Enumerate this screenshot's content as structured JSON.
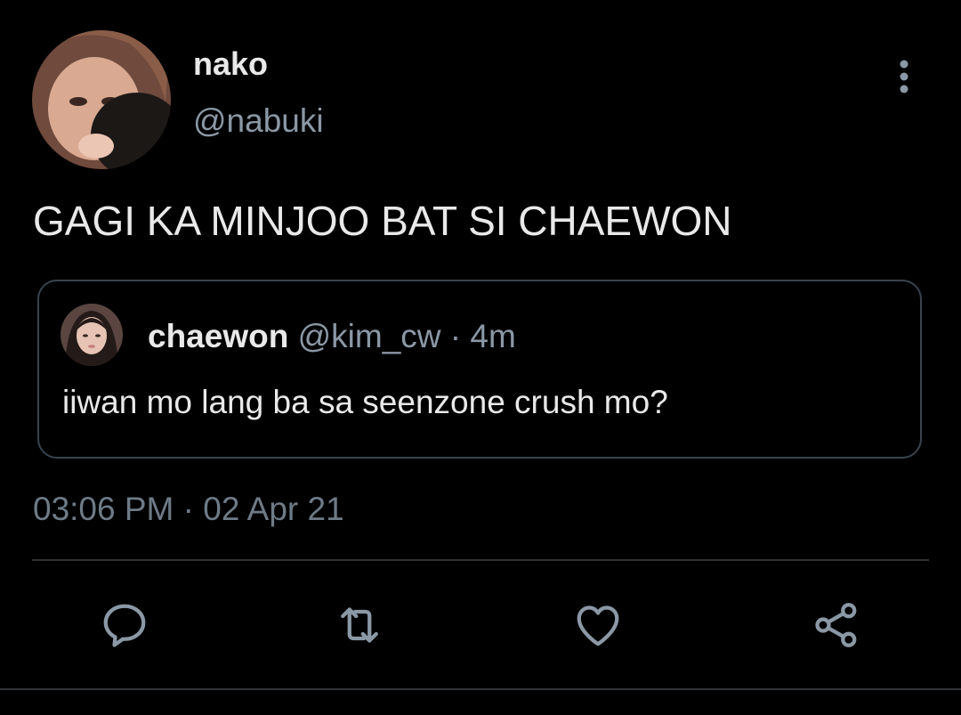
{
  "tweet": {
    "author": {
      "display_name": "nako",
      "handle": "@nabuki",
      "avatar_icon": "profile-photo"
    },
    "text": "GAGI KA MINJOO BAT SI CHAEWON",
    "timestamp": "03:06 PM · 02 Apr 21",
    "more_icon": "vertical-ellipsis-icon"
  },
  "quoted_tweet": {
    "display_name": "chaewon",
    "handle": "@kim_cw",
    "separator": "·",
    "time_ago": "4m",
    "text": "iiwan mo lang ba sa seenzone crush mo?"
  },
  "actions": [
    {
      "name": "reply",
      "icon": "speech-bubble-icon"
    },
    {
      "name": "retweet",
      "icon": "retweet-arrows-icon"
    },
    {
      "name": "like",
      "icon": "heart-icon"
    },
    {
      "name": "share",
      "icon": "share-icon"
    }
  ],
  "colors": {
    "background": "#000000",
    "primary_text": "#e9e9e9",
    "secondary_text": "#8b98a5",
    "border": "#38444d",
    "icon": "#8b98a5"
  }
}
